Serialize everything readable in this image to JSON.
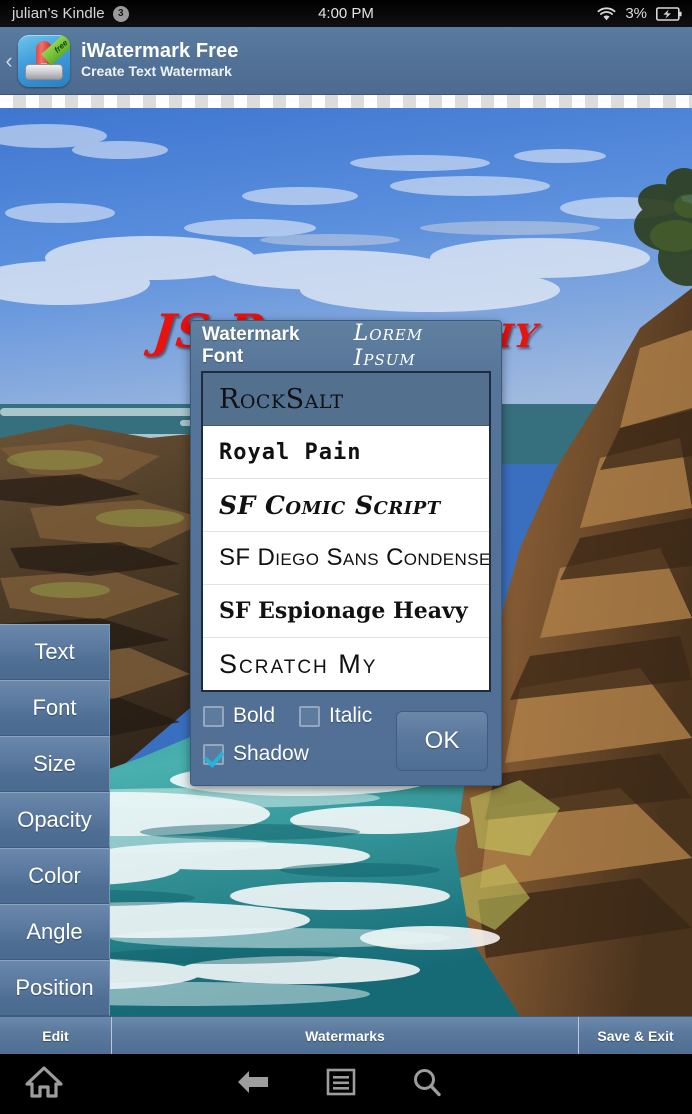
{
  "status_bar": {
    "device": "julian's Kindle",
    "notification_count": "3",
    "time": "4:00 PM",
    "battery_percent": "3%",
    "wifi_icon": "wifi-icon",
    "battery_icon": "battery-charging-icon"
  },
  "app_header": {
    "back_icon": "back-chevron-icon",
    "app_icon": "iwatermark-app-icon",
    "ribbon_label": "free",
    "title": "iWatermark Free",
    "subtitle": "Create Text Watermark"
  },
  "canvas": {
    "watermark_text": "JS Photography",
    "watermark_color": "#e8120e"
  },
  "sidebar": {
    "items": [
      {
        "label": "Text"
      },
      {
        "label": "Font"
      },
      {
        "label": "Size"
      },
      {
        "label": "Opacity"
      },
      {
        "label": "Color"
      },
      {
        "label": "Angle"
      },
      {
        "label": "Position"
      }
    ]
  },
  "dialog": {
    "title": "Watermark Font",
    "preview_text": "Lorem Ipsum",
    "fonts": [
      {
        "label": "RockSalt",
        "selected": true
      },
      {
        "label": "Royal Pain",
        "selected": false
      },
      {
        "label": "SF Comic Script",
        "selected": false
      },
      {
        "label": "SF Diego Sans Condensed",
        "selected": false
      },
      {
        "label": "SF Espionage Heavy",
        "selected": false
      },
      {
        "label": "Scratch My",
        "selected": false
      }
    ],
    "options": [
      {
        "label": "Bold",
        "checked": false
      },
      {
        "label": "Italic",
        "checked": false
      },
      {
        "label": "Shadow",
        "checked": true
      }
    ],
    "ok_label": "OK",
    "selected_row_color": "#53708f",
    "check_color": "#23b5d9"
  },
  "toolbar": {
    "edit_label": "Edit",
    "watermarks_label": "Watermarks",
    "save_exit_label": "Save & Exit"
  },
  "navbar": {
    "home_icon": "home-icon",
    "back_icon": "back-arrow-icon",
    "menu_icon": "menu-icon",
    "search_icon": "search-icon"
  }
}
